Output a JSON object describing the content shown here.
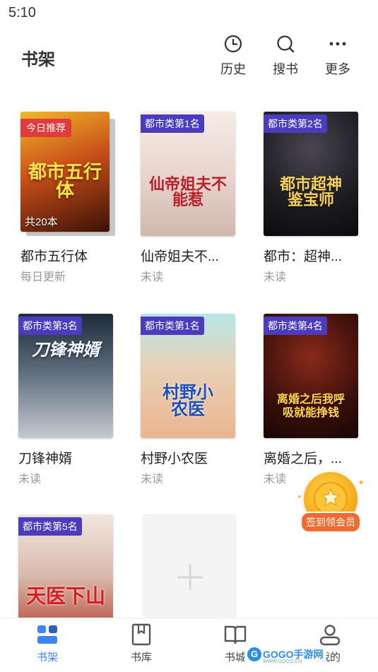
{
  "status_bar": {
    "time": "5:10"
  },
  "header": {
    "title": "书架",
    "actions": [
      {
        "label": "历史",
        "icon": "clock-icon"
      },
      {
        "label": "搜书",
        "icon": "search-icon"
      },
      {
        "label": "更多",
        "icon": "more-dots-icon"
      }
    ]
  },
  "books": [
    {
      "title": "都市五行体",
      "status": "每日更新",
      "badge": "今日推荐",
      "count": "共20本",
      "cover_text": "都市五行体",
      "colors": [
        "#e8a21a",
        "#4a1607"
      ]
    },
    {
      "title": "仙帝姐夫不...",
      "status": "未读",
      "badge": "都市类第1名",
      "cover_text": "仙帝姐夫不能惹",
      "colors": [
        "#f3e6de",
        "#c9b3ab"
      ]
    },
    {
      "title": "都市：超神...",
      "status": "未读",
      "badge": "都市类第2名",
      "cover_text": "都市超神鉴宝师",
      "colors": [
        "#2b2a2e",
        "#0f0e12"
      ]
    },
    {
      "title": "刀锋神婿",
      "status": "未读",
      "badge": "都市类第3名",
      "cover_text": "刀锋神婿",
      "colors": [
        "#4f5b6a",
        "#b6bcc6"
      ]
    },
    {
      "title": "村野小农医",
      "status": "未读",
      "badge": "都市类第1名",
      "cover_text": "村野小农医",
      "colors": [
        "#9fd4d8",
        "#e8c49a"
      ]
    },
    {
      "title": "离婚之后，...",
      "status": "未读",
      "badge": "都市类第4名",
      "cover_text": "离婚之后我呼吸就能挣钱",
      "colors": [
        "#6b1a12",
        "#1d0b08"
      ]
    },
    {
      "title": "",
      "status": "",
      "badge": "都市类第5名",
      "cover_text": "天医下山",
      "colors": [
        "#e9d7cf",
        "#b33a2a"
      ]
    }
  ],
  "add_tile": {
    "icon": "plus-icon"
  },
  "checkin": {
    "label": "签到领会员"
  },
  "tabbar": {
    "tabs": [
      {
        "label": "书架",
        "icon": "bookshelf-icon",
        "active": true
      },
      {
        "label": "书库",
        "icon": "bookmark-book-icon",
        "active": false
      },
      {
        "label": "书城",
        "icon": "open-book-icon",
        "active": false
      },
      {
        "label": "我的",
        "icon": "user-icon",
        "active": false
      }
    ]
  },
  "watermark": {
    "text": "GOGO手游网",
    "sub": "WWW.GOGO.CN",
    "logo": "G"
  }
}
